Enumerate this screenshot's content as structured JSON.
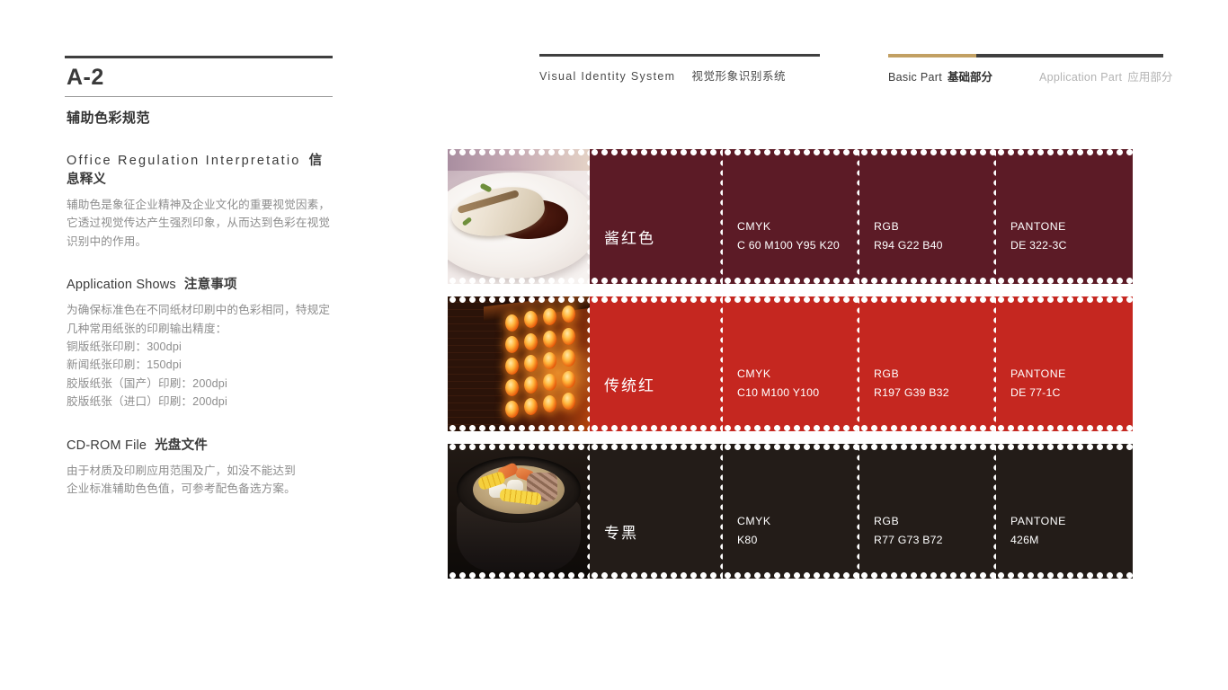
{
  "left": {
    "page_code": "A-2",
    "section_title_cn": "辅助色彩规范",
    "blocks": [
      {
        "head_en": "Office  Regulation  Interpretatio",
        "head_cn": "信息释义",
        "lines": [
          "辅助色是象征企业精神及企业文化的重要视觉因素，",
          "它透过视觉传达产生强烈印象，从而达到色彩在视觉",
          "识别中的作用。"
        ]
      },
      {
        "head_en": "Application Shows",
        "head_cn": "注意事项",
        "lines": [
          "为确保标准色在不同纸材印刷中的色彩相同，特规定",
          "几种常用纸张的印刷输出精度：",
          "铜版纸张印刷：300dpi",
          "新闻纸张印刷：150dpi",
          "胶版纸张（国产）印刷：200dpi",
          "胶版纸张（进口）印刷：200dpi"
        ]
      },
      {
        "head_en": "CD-ROM File",
        "head_cn": "光盘文件",
        "lines": [
          "由于材质及印刷应用范围及广，如没不能达到",
          "企业标准辅助色色值，可参考配色备选方案。"
        ]
      }
    ]
  },
  "header": {
    "vis_en": "Visual  Identity  System",
    "vis_cn": "视觉形象识别系统",
    "basic_en": "Basic Part",
    "basic_cn": "基础部分",
    "app_en": "Application Part",
    "app_cn": "应用部分",
    "accent_gold": "#c2a063",
    "rule_dark": "#3f3f3f"
  },
  "swatches": [
    {
      "name": "酱红色",
      "hex": "#5c1b26",
      "photo_alt": "肠粉照片",
      "photo_name": "rice-roll-photo",
      "specs": [
        {
          "key": "CMYK",
          "value": "C 60 M100 Y95 K20"
        },
        {
          "key": "RGB",
          "value": "R94 G22 B40"
        },
        {
          "key": "PANTONE",
          "value": "DE 322-3C"
        }
      ]
    },
    {
      "name": "传统红",
      "hex": "#c52720",
      "photo_alt": "红灯笼照片",
      "photo_name": "lanterns-photo",
      "specs": [
        {
          "key": "CMYK",
          "value": "C10 M100 Y100"
        },
        {
          "key": "RGB",
          "value": "R197 G39 B32"
        },
        {
          "key": "PANTONE",
          "value": "DE 77-1C"
        }
      ]
    },
    {
      "name": "专黑",
      "hex": "#231c18",
      "photo_alt": "砂锅汤照片",
      "photo_name": "claypot-soup-photo",
      "specs": [
        {
          "key": "CMYK",
          "value": "K80"
        },
        {
          "key": "RGB",
          "value": "R77 G73 B72"
        },
        {
          "key": "PANTONE",
          "value": "426M"
        }
      ]
    }
  ]
}
